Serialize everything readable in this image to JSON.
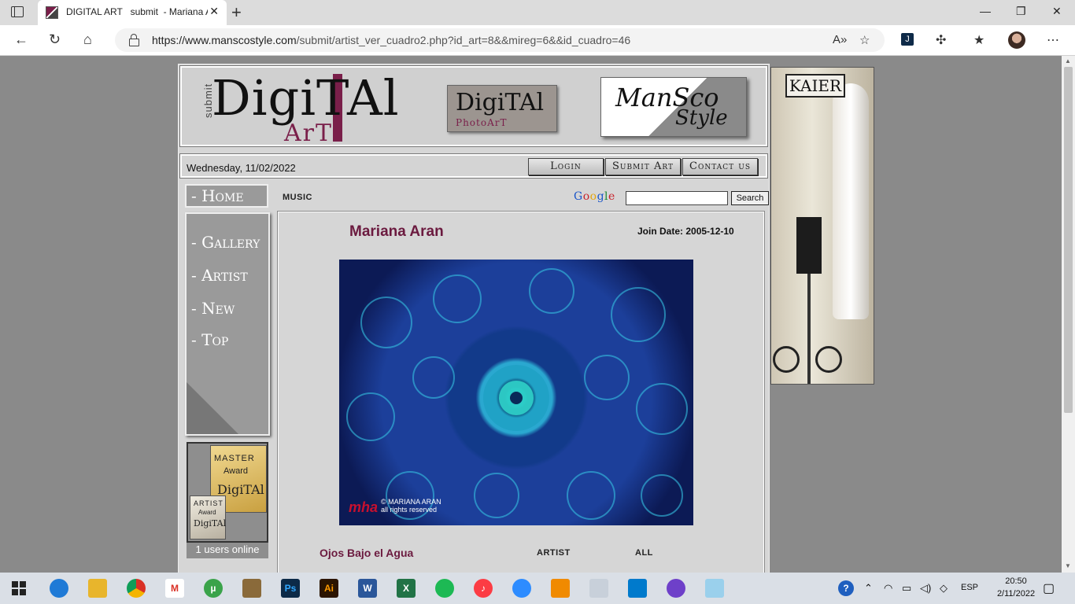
{
  "browser": {
    "tab_title": "DIGITAL ART   submit  - Mariana Aran",
    "url_host": "https://www.manscostyle.com",
    "url_path": "/submit/artist_ver_cuadro2.php?id_art=8&&mireg=6&&id_cuadro=46"
  },
  "header": {
    "logo_submit": "submit",
    "logo_digital": "DigiTAl",
    "logo_art": "ArT",
    "photoart_top": "DigiTAl",
    "photoart_bottom": "PhotoArT",
    "mansco_top": "ManSco",
    "mansco_bottom": "Style"
  },
  "infobar": {
    "date": "Wednesday, 11/02/2022",
    "login": "Login",
    "submit_art": "Submit Art",
    "contact": "Contact us"
  },
  "nav": {
    "home": "- Home",
    "gallery": "- Gallery",
    "artist": "- Artist",
    "new": "- New",
    "top": "- Top"
  },
  "awards": {
    "master_l1": "MASTER",
    "master_l2": "Award",
    "master_l3": "DigiTAl",
    "artist_l1": "ARTIST",
    "artist_l2": "Award",
    "artist_l3": "DigiTAl",
    "online": "1 users online"
  },
  "content": {
    "category": "MUSIC",
    "google_label": "Google",
    "search_button": "Search",
    "search_value": "",
    "artist_name": "Mariana Aran",
    "join_date": "Join Date: 2005-12-10",
    "watermark_logo": "mha",
    "watermark_copy": "© MARIANA ARAN",
    "watermark_rights": "all rights reserved",
    "artwork_title": "Ojos Bajo el Agua",
    "artist_link": "ARTIST",
    "all_link": "ALL"
  },
  "ad": {
    "brand": "KAIER"
  },
  "taskbar": {
    "lang": "ESP",
    "time": "20:50",
    "date": "2/11/2022"
  }
}
